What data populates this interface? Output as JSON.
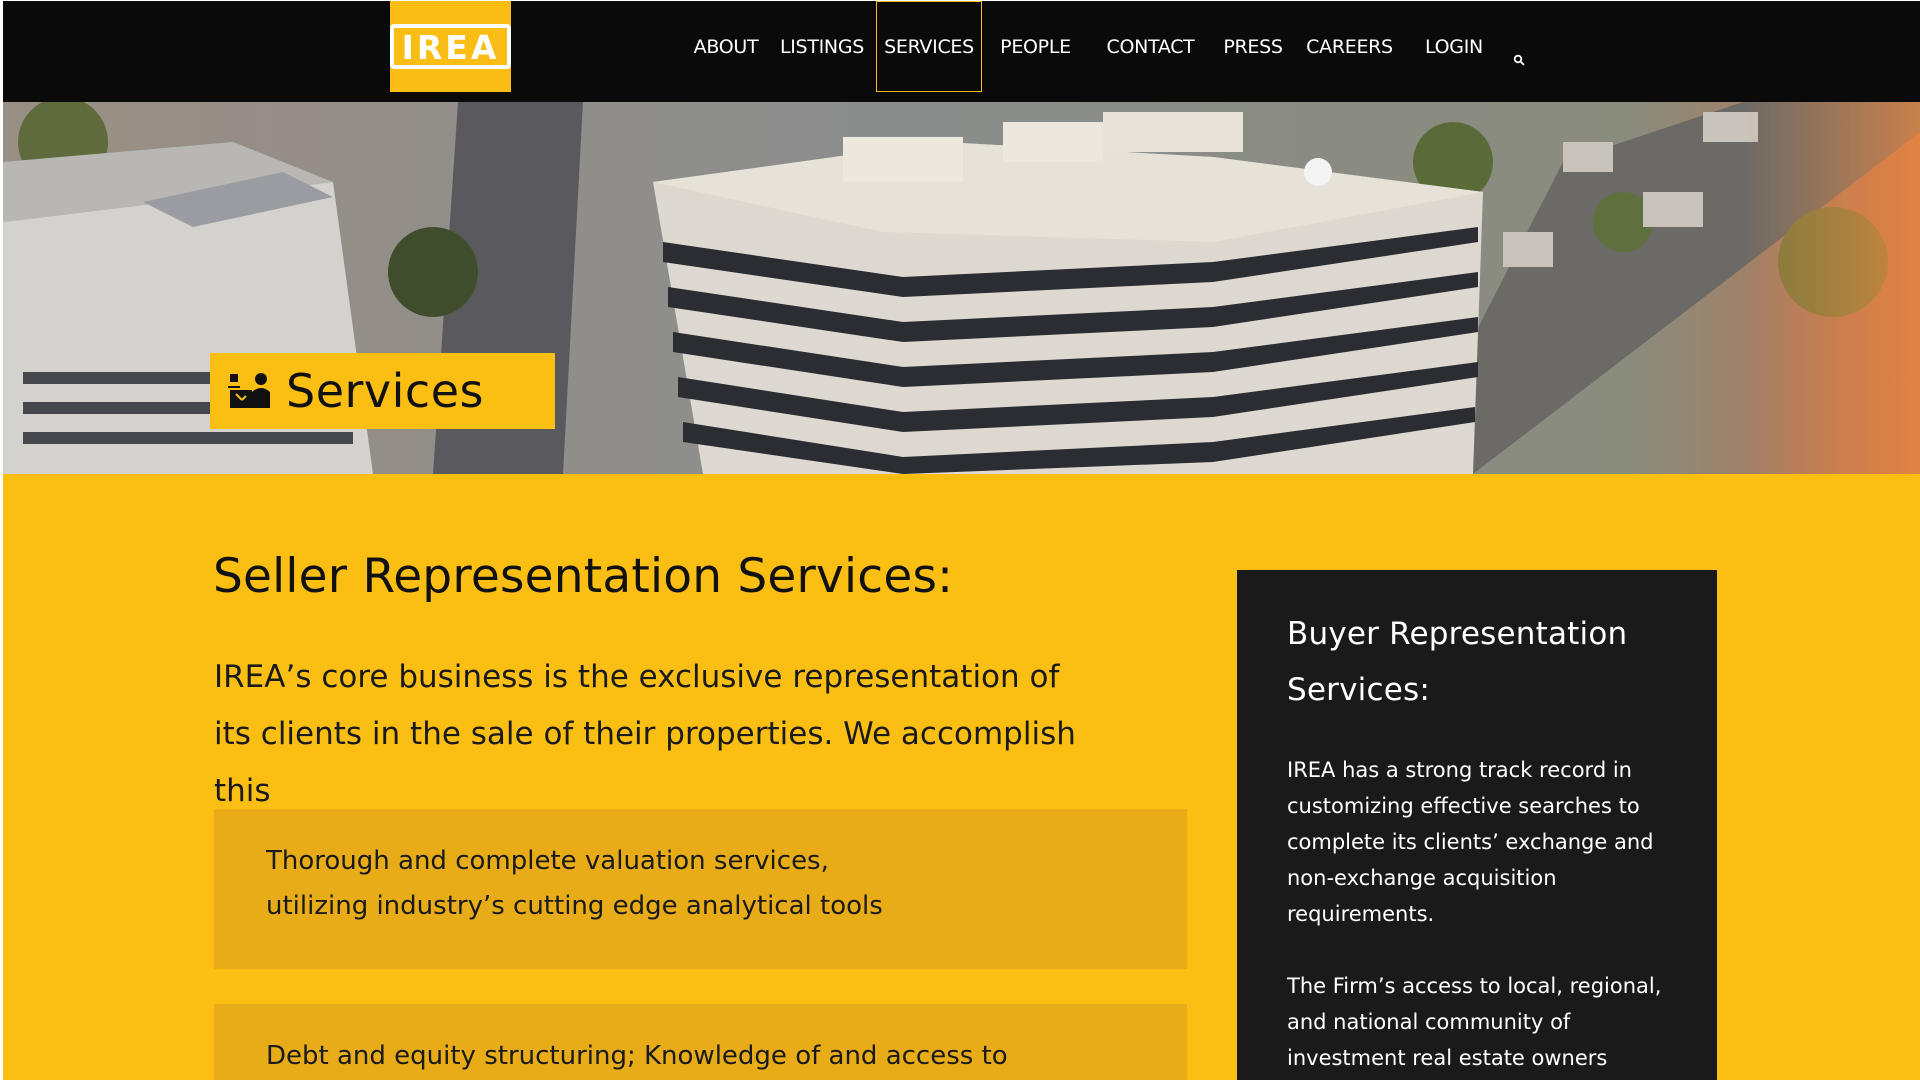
{
  "brand": {
    "logo_text": "IREA",
    "accent": "#fbbf14",
    "dark": "#0a0a0a"
  },
  "nav": {
    "items": [
      {
        "label": "ABOUT"
      },
      {
        "label": "LISTINGS"
      },
      {
        "label": "SERVICES",
        "active": true
      },
      {
        "label": "PEOPLE"
      },
      {
        "label": "CONTACT"
      },
      {
        "label": "PRESS"
      },
      {
        "label": "CAREERS"
      },
      {
        "label": "LOGIN"
      }
    ],
    "search_icon": "search-icon"
  },
  "hero": {
    "title": "Services",
    "icon": "services-person-icon",
    "image": "aerial-office-building-photo"
  },
  "seller": {
    "heading": "Seller Representation Services:",
    "intro": "IREA’s core business is the exclusive representation of its clients in the sale of their properties. We accomplish this",
    "features": [
      {
        "line1": "Thorough and complete valuation services,",
        "line2": "utilizing industry’s cutting edge analytical tools"
      },
      {
        "line1": "Debt and equity structuring; Knowledge of and access to",
        "line2": ""
      }
    ]
  },
  "buyer": {
    "heading": "Buyer Representation Services:",
    "paragraph1": "IREA has a strong track record in customizing effective searches to complete its clients’ exchange and non-exchange acquisition requirements.",
    "paragraph2": "The Firm’s access to local, regional, and national community of investment real estate owners facilitates the sharing of deal"
  }
}
